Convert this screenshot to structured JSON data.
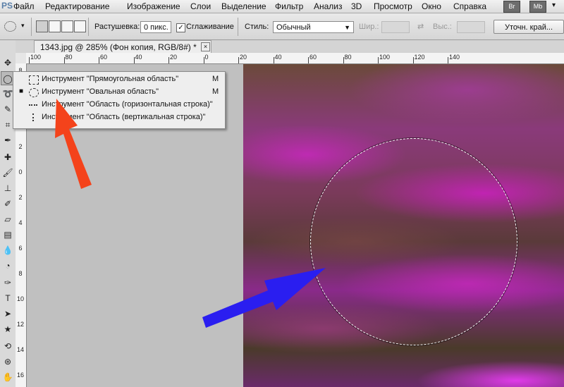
{
  "app": {
    "logo": "PS",
    "brand_color": "#5a7fa8"
  },
  "menubar": {
    "items": [
      "Файл",
      "Редактирование",
      "Изображение",
      "Слои",
      "Выделение",
      "Фильтр",
      "Анализ",
      "3D",
      "Просмотр",
      "Окно",
      "Справка"
    ],
    "right_buttons": [
      "Br",
      "Mb"
    ]
  },
  "options_bar": {
    "feather_label": "Растушевка:",
    "feather_value": "0 пикс.",
    "antialias_label": "Сглаживание",
    "antialias_checked": true,
    "style_label": "Стиль:",
    "style_value": "Обычный",
    "width_label": "Шир.:",
    "height_label": "Выс.:",
    "refine_button": "Уточн. край..."
  },
  "document": {
    "tab_title": "1343.jpg @ 285% (Фон копия, RGB/8#) *",
    "close_glyph": "×"
  },
  "ruler": {
    "h_labels": [
      "100",
      "80",
      "60",
      "40",
      "20",
      "0",
      "20",
      "40",
      "60",
      "80",
      "100",
      "120",
      "140"
    ],
    "v_labels": [
      "8",
      "6",
      "4",
      "2",
      "0",
      "2",
      "4",
      "6",
      "8",
      "10",
      "12",
      "14",
      "16"
    ]
  },
  "flyout": {
    "items": [
      {
        "label": "Инструмент \"Прямоугольная область\"",
        "key": "M",
        "icon": "rect-marquee-icon",
        "active": false
      },
      {
        "label": "Инструмент \"Овальная область\"",
        "key": "M",
        "icon": "ellipse-marquee-icon",
        "active": true
      },
      {
        "label": "Инструмент \"Область (горизонтальная строка)\"",
        "key": "",
        "icon": "row-marquee-icon",
        "active": false
      },
      {
        "label": "Инструмент \"Область (вертикальная строка)\"",
        "key": "",
        "icon": "column-marquee-icon",
        "active": false
      }
    ],
    "active_bullet": "■"
  },
  "colors": {
    "annotation_red": "#f4431b",
    "annotation_blue": "#2a1ef0"
  }
}
